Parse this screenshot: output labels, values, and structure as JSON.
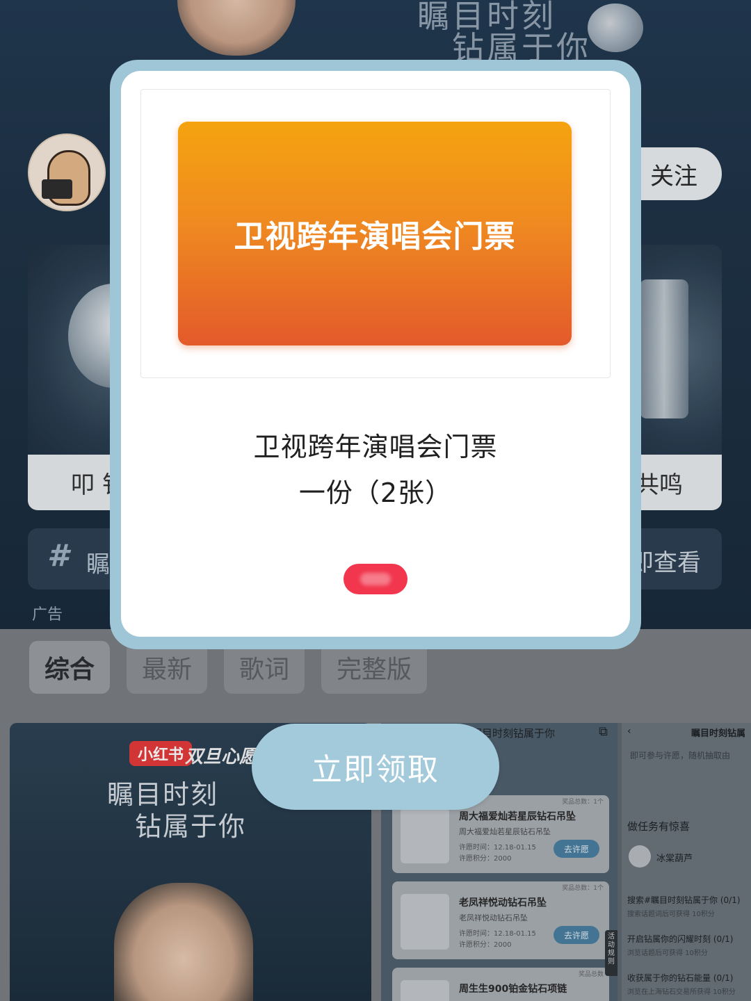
{
  "banner": {
    "slogan_line1": "瞩目时刻",
    "slogan_line2": "钻属于你"
  },
  "profile": {
    "follow_label": "关注"
  },
  "products": {
    "left_caption": "叩 钅",
    "right_caption": "共鸣"
  },
  "topic": {
    "text": "瞩",
    "action": "即查看"
  },
  "ad_label": "广告",
  "tabs": [
    {
      "label": "综合",
      "active": true
    },
    {
      "label": "最新",
      "active": false
    },
    {
      "label": "歌词",
      "active": false
    },
    {
      "label": "完整版",
      "active": false
    }
  ],
  "post_left": {
    "badge": "小红书",
    "event": "双旦心愿派对",
    "slogan_line1": "瞩目时刻",
    "slogan_line2": "钻属于你"
  },
  "post_right": {
    "title": "瞩目时刻钻属于你",
    "prizes": [
      {
        "name": "周大福爱灿若星辰钻石吊坠",
        "sub": "周大福爱灿若星辰钻石吊坠",
        "time": "许愿时间：12.18-01.15",
        "points": "许愿积分：2000",
        "button": "去许愿",
        "total": "奖品总数：1个"
      },
      {
        "name": "老凤祥悦动钻石吊坠",
        "sub": "老凤祥悦动钻石吊坠",
        "time": "许愿时间：12.18-01.15",
        "points": "许愿积分：2000",
        "button": "去许愿",
        "total": "奖品总数：1个"
      },
      {
        "name": "周生生900铂金钻石项链",
        "total": "奖品总数"
      }
    ],
    "rules_tab": "活动规则",
    "side": {
      "title": "瞩目时刻钻属",
      "note": "即可参与许愿，随机抽取由",
      "tasks_heading": "做任务有惊喜",
      "user": "冰棠葫芦",
      "tasks": [
        {
          "title": "搜索#瞩目时刻钻属于你 (0/1)",
          "sub": "搜索话题词后可获得 10积分"
        },
        {
          "title": "开启钻属你的闪耀时刻 (0/1)",
          "sub": "浏览话题后可获得 10积分"
        },
        {
          "title": "收获属于你的钻石能量 (0/1)",
          "sub": "浏览在上海钻石交易所获得 10积分"
        }
      ]
    }
  },
  "modal": {
    "ticket_title": "卫视跨年演唱会门票",
    "prize_name": "卫视跨年演唱会门票",
    "prize_qty": "一份（2张）",
    "claim_label": "立即领取",
    "frame_color": "#9fc6d6",
    "ticket_gradient": [
      "#f5a310",
      "#e35a2b"
    ],
    "pill_color": "#f1364d"
  }
}
